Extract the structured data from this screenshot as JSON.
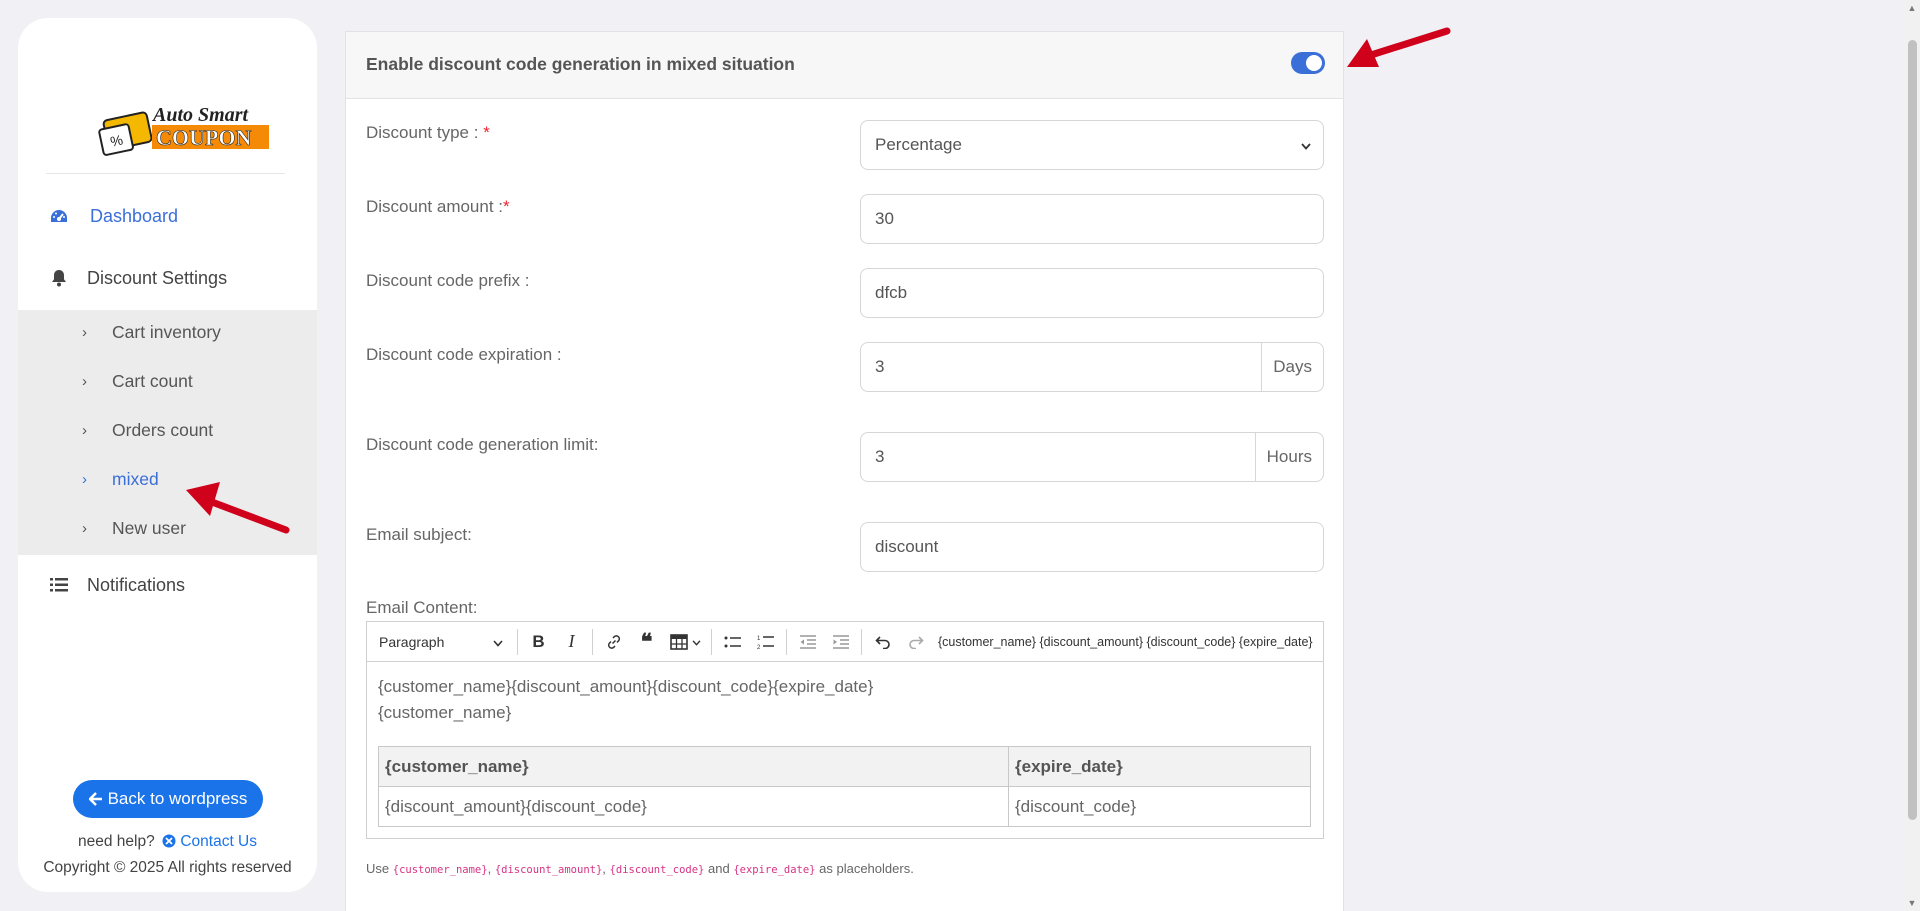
{
  "sidebar": {
    "logo": {
      "line1": "Auto Smart",
      "line2": "COUPON"
    },
    "nav": {
      "dashboard": "Dashboard",
      "discount_settings": "Discount Settings",
      "notifications": "Notifications"
    },
    "submenu": [
      "Cart inventory",
      "Cart count",
      "Orders count",
      "mixed",
      "New user"
    ],
    "back_button": "Back to wordpress",
    "help_text": "need help?",
    "contact_link": "Contact Us",
    "copyright": "Copyright © 2025 All rights reserved"
  },
  "card": {
    "title": "Enable discount code generation in mixed situation",
    "toggle_on": true,
    "fields": {
      "discount_type": {
        "label": "Discount type :",
        "value": "Percentage"
      },
      "discount_amount": {
        "label": "Discount amount :",
        "value": "30"
      },
      "prefix": {
        "label": "Discount code prefix :",
        "value": "dfcb"
      },
      "expiration": {
        "label": "Discount code expiration :",
        "value": "3",
        "suffix": "Days"
      },
      "limit": {
        "label": "Discount code generation limit:",
        "value": "3",
        "suffix": "Hours"
      },
      "email_subject": {
        "label": "Email subject:",
        "value": "discount"
      }
    },
    "required_mark": "*",
    "email_content_label": "Email Content:",
    "editor": {
      "paragraph": "Paragraph",
      "toolbar_placeholders": "{customer_name} {discount_amount} {discount_code} {expire_date}",
      "line1": "{customer_name}{discount_amount}{discount_code}{expire_date}",
      "line2": "{customer_name}",
      "table": {
        "head": [
          "{customer_name}",
          "{expire_date}"
        ],
        "row": [
          "{discount_amount}{discount_code}",
          "{discount_code}"
        ]
      }
    },
    "placeholders_note": {
      "use": "Use",
      "p1": "{customer_name}",
      "comma1": ",",
      "p2": "{discount_amount}",
      "comma2": ",",
      "p3": "{discount_code}",
      "and": "and",
      "p4": "{expire_date}",
      "suffix": "as placeholders."
    }
  },
  "colors": {
    "accent": "#3a6fd8",
    "button": "#1a73e8",
    "annotation_arrow": "#d0021b",
    "required": "#e22233"
  }
}
